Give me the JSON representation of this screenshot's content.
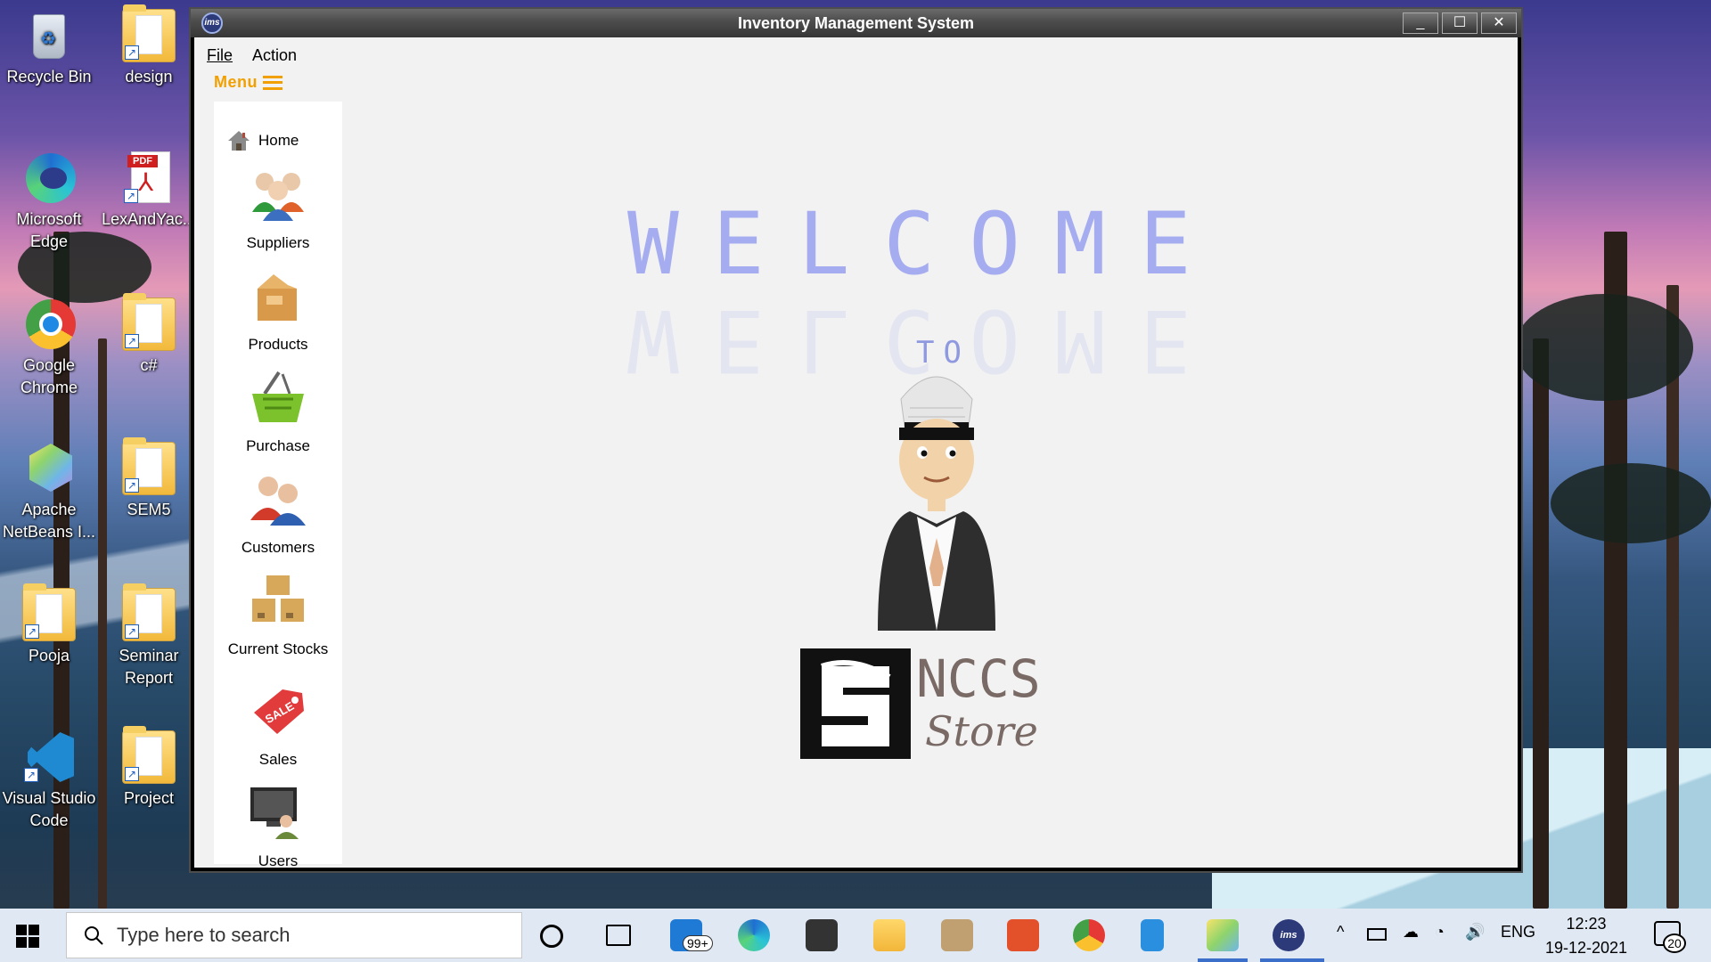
{
  "desktop": {
    "icons": [
      {
        "label": "Recycle Bin"
      },
      {
        "label": "design"
      },
      {
        "label": "Microsoft Edge"
      },
      {
        "label": "LexAndYac..."
      },
      {
        "label": "Google Chrome"
      },
      {
        "label": "c#"
      },
      {
        "label": "Apache NetBeans I..."
      },
      {
        "label": "SEM5"
      },
      {
        "label": "Pooja"
      },
      {
        "label": "Seminar Report"
      },
      {
        "label": "Visual Studio Code"
      },
      {
        "label": "Project"
      }
    ]
  },
  "window": {
    "title": "Inventory Management System",
    "app_icon_text": "ims",
    "controls": {
      "minimize": "_",
      "maximize": "☐",
      "close": "✕"
    },
    "menubar": {
      "file": "File",
      "action": "Action"
    },
    "menu_toggle": "Menu",
    "sidebar": {
      "items": [
        {
          "label": "Home",
          "icon": "home-icon"
        },
        {
          "label": "Suppliers",
          "icon": "suppliers-icon"
        },
        {
          "label": "Products",
          "icon": "products-icon"
        },
        {
          "label": "Purchase",
          "icon": "purchase-basket-icon"
        },
        {
          "label": "Customers",
          "icon": "customers-icon"
        },
        {
          "label": "Current Stocks",
          "icon": "stock-boxes-icon"
        },
        {
          "label": "Sales",
          "icon": "sale-tag-icon"
        },
        {
          "label": "Users",
          "icon": "users-icon"
        }
      ]
    },
    "main": {
      "welcome": "WELCOME",
      "to": "TO",
      "store_name": "NCCS",
      "store_sub": "Store"
    }
  },
  "taskbar": {
    "search_placeholder": "Type here to search",
    "mail_badge": "99+",
    "language": "ENG",
    "time": "12:23",
    "date": "19-12-2021",
    "notification_count": "20",
    "app_icon_text": "ims"
  },
  "colors": {
    "welcome_text": "#a5adf0",
    "menu_accent": "#f2a000",
    "store_text": "#7a6a66",
    "taskbar_bg": "#dfe8f3"
  }
}
